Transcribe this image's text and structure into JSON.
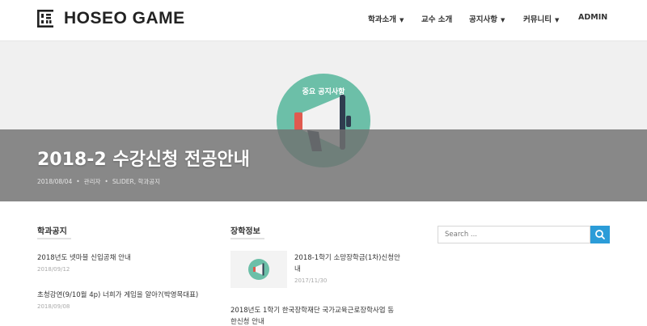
{
  "site": {
    "title": "HOSEO GAME"
  },
  "nav": {
    "items": [
      {
        "label": "학과소개",
        "dropdown": true
      },
      {
        "label": "교수 소개",
        "dropdown": false
      },
      {
        "label": "공지사항",
        "dropdown": true
      },
      {
        "label": "커뮤니티",
        "dropdown": true
      },
      {
        "label": "ADMIN",
        "dropdown": false
      }
    ]
  },
  "hero": {
    "badge": "중요 공지사항",
    "title": "2018-2 수강신청 전공안내",
    "meta": {
      "date": "2018/08/04",
      "author": "관리자",
      "tags": "SLIDER, 학과공지"
    }
  },
  "widgets": {
    "dept_notice": {
      "title": "학과공지",
      "posts": [
        {
          "title": "2018년도 넷마블 신입공채 안내",
          "date": "2018/09/12"
        },
        {
          "title": "초청강연(9/10월 4p) 너희가 게임을 알아?(박영목대표)",
          "date": "2018/09/08"
        }
      ]
    },
    "scholarship": {
      "title": "장학정보",
      "posts": [
        {
          "title_line1": "2018-1학기 소망장학금(1차)신청안",
          "title_line2": "내",
          "date": "2017/11/30"
        },
        {
          "title_line1": "2018년도 1학기 한국장학재단 국가교육근로장학사업 동",
          "title_line2": "한신청 안내"
        }
      ]
    },
    "search": {
      "placeholder": "Search ..."
    }
  },
  "colors": {
    "accent": "#2b9cd8",
    "hero_circle": "#6cbfa8",
    "hero_band": "#707070",
    "megaphone_red": "#e05a4f",
    "megaphone_dark": "#2f3d4f"
  }
}
